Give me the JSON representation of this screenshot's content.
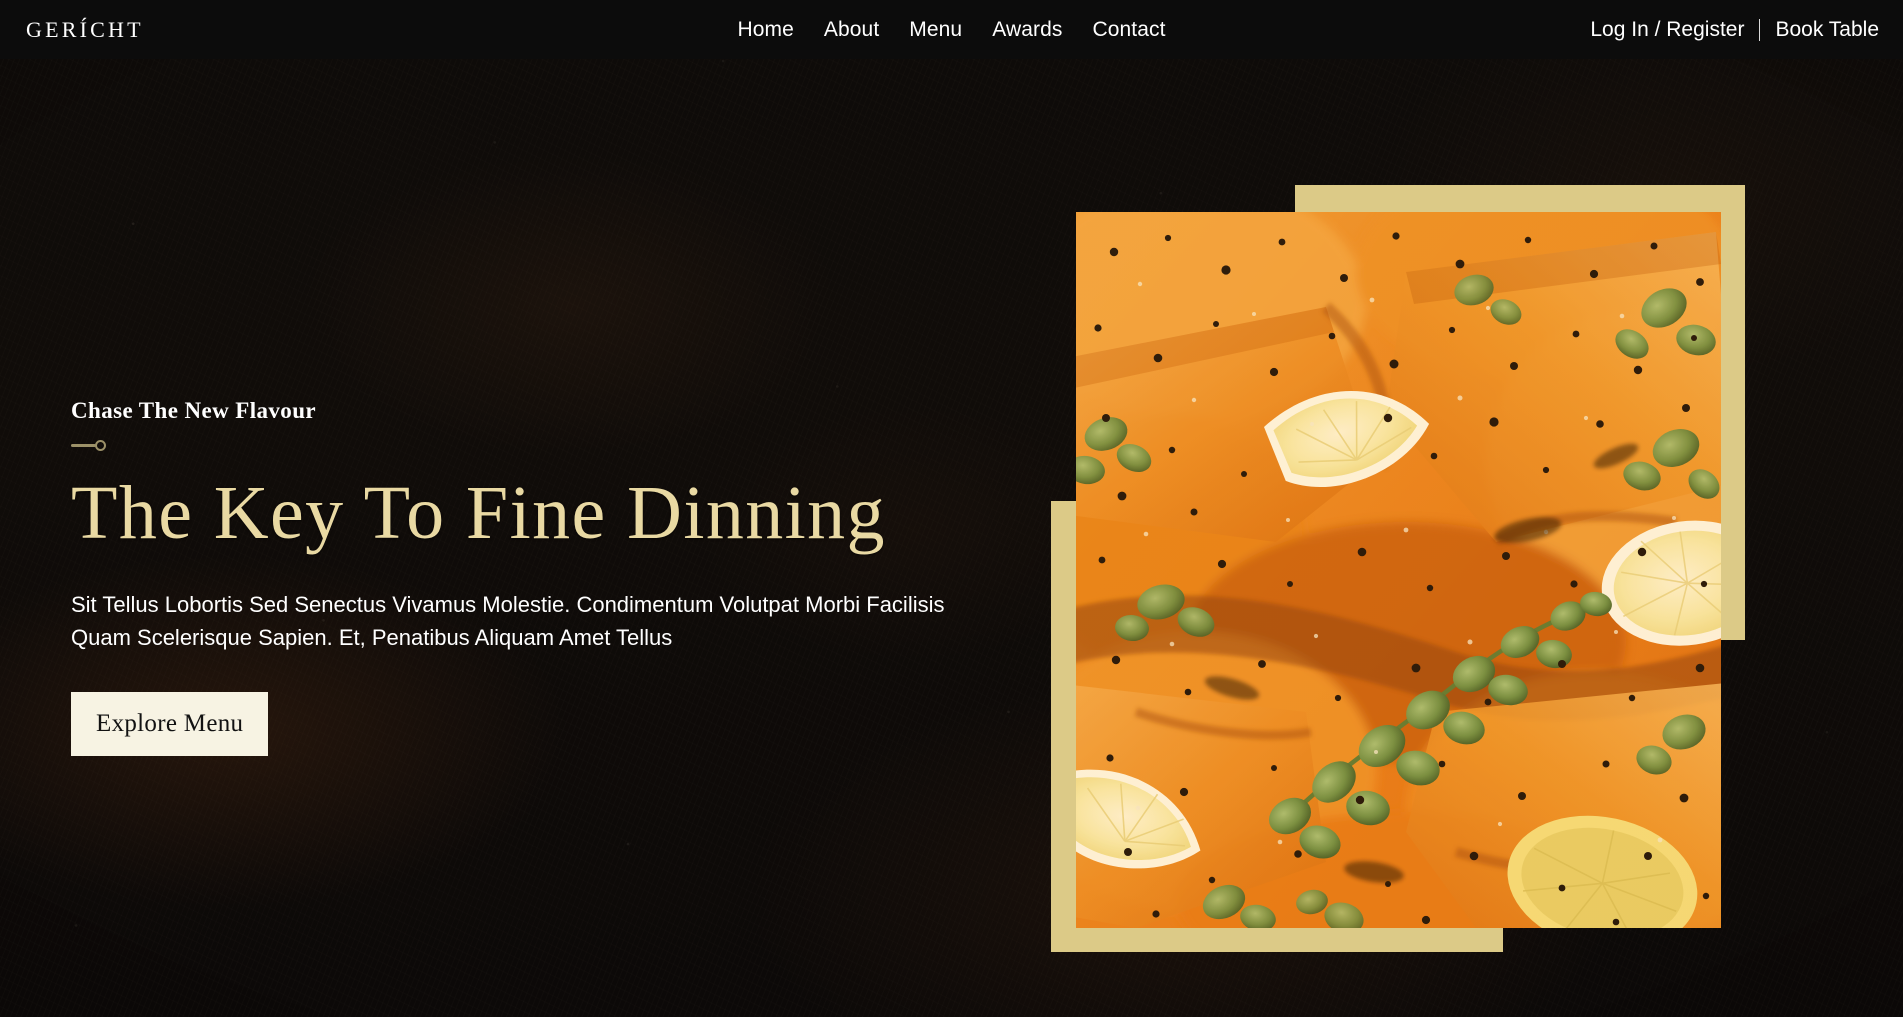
{
  "navbar": {
    "logo": "GERÍCHT",
    "links": [
      {
        "label": "Home"
      },
      {
        "label": "About"
      },
      {
        "label": "Menu"
      },
      {
        "label": "Awards"
      },
      {
        "label": "Contact"
      }
    ],
    "login_label": "Log In / Register",
    "divider": "|",
    "book_label": "Book Table"
  },
  "hero": {
    "subtitle": "Chase The New Flavour",
    "title": "The Key To Fine Dinning",
    "body": "Sit Tellus Lobortis Sed Senectus Vivamus Molestie. Condimentum Volutpat Morbi Facilisis Quam Scelerisque Sapien. Et, Penatibus Aliquam Amet Tellus",
    "cta_label": "Explore Menu",
    "image_alt": "Salmon fillets in orange curry sauce with lemon wedges, oregano and cracked black pepper"
  },
  "colors": {
    "gold": "#DCCA87",
    "heading_gold": "#E9D9A3",
    "background": "#0C0C0C",
    "button_bg": "#F7F3E3",
    "text_white": "#FFFFFF",
    "spoon_mark": "#9C9168"
  }
}
